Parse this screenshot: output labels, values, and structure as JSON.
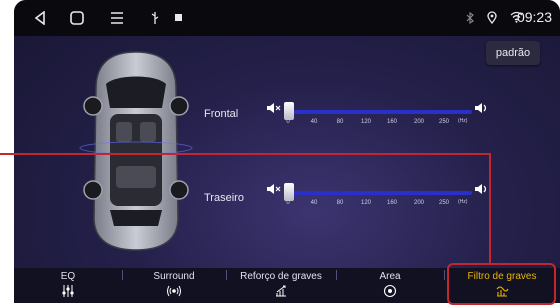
{
  "status_bar": {
    "time": "09:23",
    "icons": [
      "back-icon",
      "home-icon",
      "menu-icon",
      "usb-icon",
      "notification-icon",
      "bluetooth-icon",
      "location-icon",
      "wifi-icon"
    ]
  },
  "preset_button": "padrão",
  "channels": [
    {
      "label": "Frontal",
      "value_hz": 0
    },
    {
      "label": "Traseiro",
      "value_hz": 0
    }
  ],
  "scale": {
    "ticks": [
      "0",
      "40",
      "80",
      "120",
      "160",
      "200",
      "250"
    ],
    "unit": "(Hz)"
  },
  "tabs": [
    {
      "label": "EQ",
      "icon": "equalizer-icon",
      "active": false
    },
    {
      "label": "Surround",
      "icon": "surround-icon",
      "active": false
    },
    {
      "label": "Reforço de graves",
      "icon": "bass-boost-icon",
      "active": false
    },
    {
      "label": "Area",
      "icon": "area-icon",
      "active": false
    },
    {
      "label": "Filtro de graves",
      "icon": "bass-filter-icon",
      "active": true
    }
  ],
  "colors": {
    "accent_active": "#e9b400",
    "slider_track": "#2a2fc8",
    "annotation": "#c1272d"
  }
}
